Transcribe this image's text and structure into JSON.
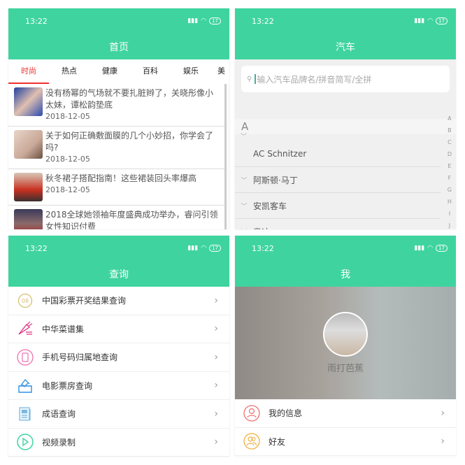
{
  "status": {
    "time": "13:22",
    "battery": "17"
  },
  "colors": {
    "brand": "#3fd49f",
    "tab_active": "#f03030"
  },
  "home": {
    "title": "首页",
    "tabs": [
      "时尚",
      "热点",
      "健康",
      "百科",
      "娱乐",
      "美"
    ],
    "news": [
      {
        "title": "没有杨幂的气场就不要扎脏辫了，关晓彤像小太妹，谭松韵垫底",
        "date": "2018-12-05"
      },
      {
        "title": "关于如何正确敷面膜的几个小妙招，你学会了吗?",
        "date": "2018-12-05"
      },
      {
        "title": "秋冬裙子搭配指南！这些裙装回头率爆高",
        "date": "2018-12-05"
      },
      {
        "title": "2018全球她领袖年度盛典成功举办，睿问引领女性知识付费",
        "date": "2018-12-05"
      }
    ]
  },
  "car": {
    "title": "汽车",
    "search_placeholder": "输入汽车品牌名/拼音简写/全拼",
    "section": "A",
    "brands": [
      "AC Schnitzer",
      "阿斯顿·马丁",
      "安凯客车",
      "奥迪"
    ],
    "index": [
      "A",
      "B",
      "C",
      "D",
      "E",
      "F",
      "G",
      "H",
      "I",
      "J"
    ]
  },
  "query": {
    "title": "查询",
    "items": [
      {
        "label": "中国彩票开奖结果查询",
        "icon": "lottery-icon"
      },
      {
        "label": "中华菜谱集",
        "icon": "carrot-icon"
      },
      {
        "label": "手机号码归属地查询",
        "icon": "phone-icon"
      },
      {
        "label": "电影票房查询",
        "icon": "ticket-icon"
      },
      {
        "label": "成语查询",
        "icon": "book-icon"
      },
      {
        "label": "视频录制",
        "icon": "play-icon"
      }
    ]
  },
  "me": {
    "title": "我",
    "username": "雨打芭蕉",
    "items": [
      {
        "label": "我的信息",
        "icon": "user-icon"
      },
      {
        "label": "好友",
        "icon": "friends-icon"
      }
    ]
  }
}
